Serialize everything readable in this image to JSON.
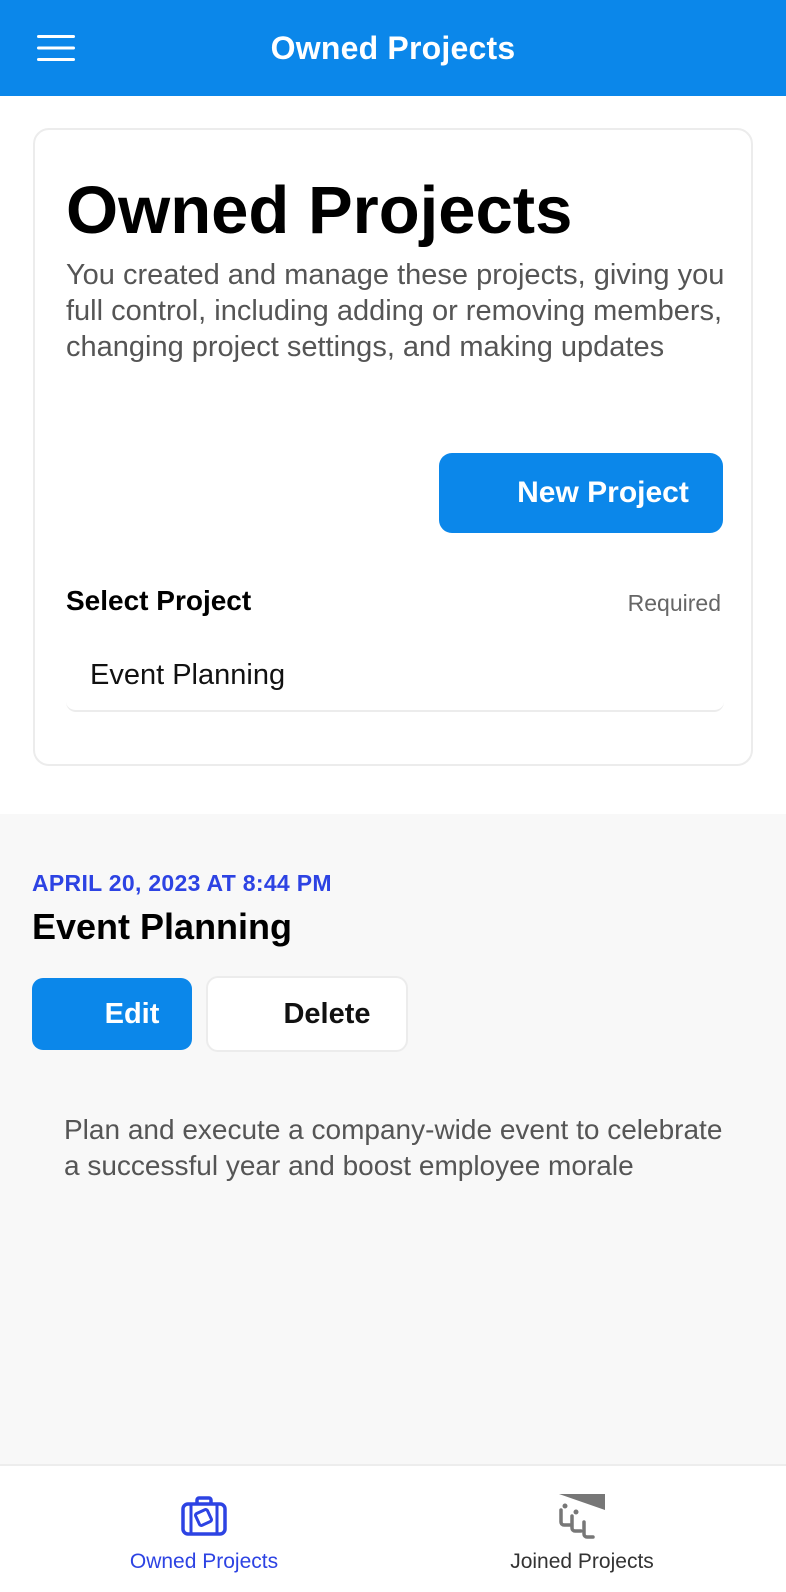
{
  "header": {
    "title": "Owned Projects",
    "menu_icon": "hamburger-menu-icon",
    "background_color": "#0b87ea"
  },
  "card": {
    "title": "Owned Projects",
    "description": "You created and manage these projects, giving you full control, including adding or removing members, changing project settings, and making updates",
    "new_project_label": "New Project",
    "select_label": "Select Project",
    "required_label": "Required",
    "selected_value": "Event Planning"
  },
  "detail": {
    "date": "APRIL 20, 2023 AT 8:44 PM",
    "title": "Event Planning",
    "edit_label": "Edit",
    "delete_label": "Delete",
    "description": "Plan and execute a company-wide event to celebrate a successful year and boost employee morale"
  },
  "bottom_nav": {
    "items": [
      {
        "label": "Owned Projects",
        "icon": "briefcase-icon",
        "active": true,
        "color": "#2d43e3"
      },
      {
        "label": "Joined Projects",
        "icon": "meeting-table-icon",
        "active": false,
        "color": "#777777"
      }
    ]
  },
  "colors": {
    "accent": "#0b87ea",
    "active_tab": "#2d43e3",
    "date_text": "#2d43e3"
  }
}
